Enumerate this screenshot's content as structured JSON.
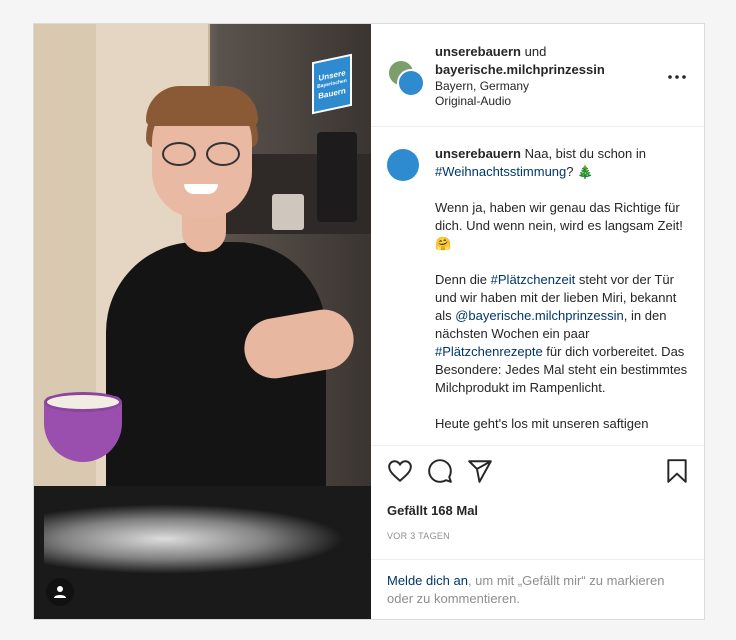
{
  "header": {
    "user1": "unserebauern",
    "and": "und",
    "user2": "bayerische.milchprinzessin",
    "location": "Bayern, Germany",
    "audio": "Original-Audio"
  },
  "media": {
    "logo_lines": [
      "Unsere",
      "Bayerischen",
      "Bauern"
    ]
  },
  "caption": {
    "username": "unserebauern",
    "intro": " Naa, bist du schon in ",
    "hashtag1": "#Weihnachtsstimmung",
    "intro_end": "? 🎄",
    "para2": "Wenn ja, haben wir genau das Richtige für dich. Und wenn nein, wird es langsam Zeit! 🤗",
    "p3_a": "Denn die ",
    "hashtag2": "#Plätzchenzeit",
    "p3_b": " steht vor der Tür und wir haben mit der lieben Miri, bekannt als ",
    "mention": "@bayerische.milchprinzessin",
    "p3_c": ", in den nächsten Wochen ein paar ",
    "hashtag3": "#Plätzchenrezepte",
    "p3_d": " für dich vorbereitet. Das Besondere: Jedes Mal steht ein bestimmtes Milchprodukt im Rampenlicht.",
    "para4": "Heute geht's los mit unseren saftigen"
  },
  "actions": {
    "likes": "Gefällt 168 Mal",
    "time": "VOR 3 TAGEN"
  },
  "login": {
    "link": "Melde dich an",
    "rest": ", um mit „Gefällt mir“ zu markieren oder zu kommentieren."
  },
  "icons": {
    "like": "heart-icon",
    "comment": "comment-icon",
    "share": "paper-plane-icon",
    "save": "bookmark-icon",
    "more": "more-icon",
    "user_tag": "user-icon"
  }
}
